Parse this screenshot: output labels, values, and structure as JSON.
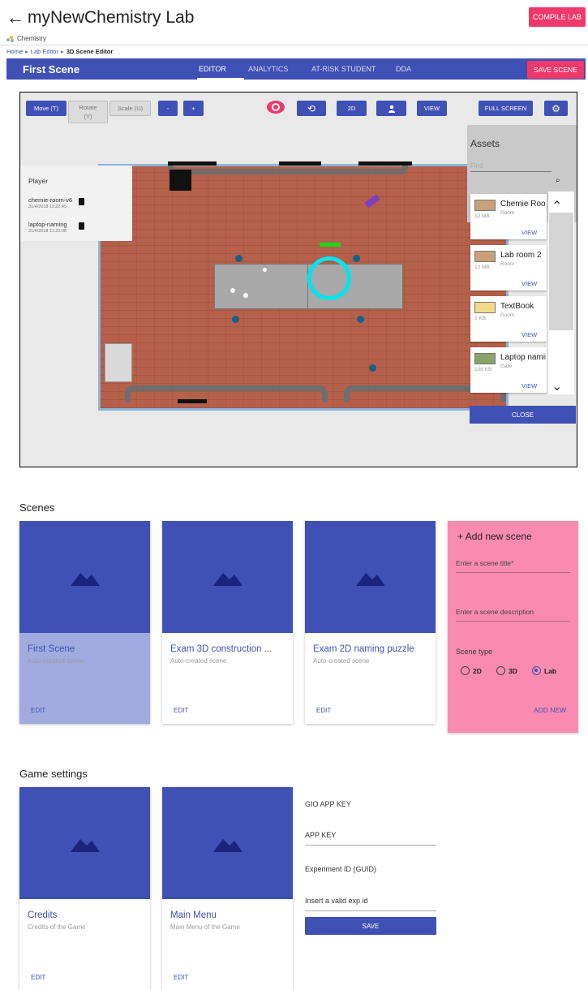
{
  "header": {
    "back_icon": "arrow-left-icon",
    "title": "myNewChemistry Lab",
    "compile_label": "COMPILE LAB",
    "category": "Chemistry"
  },
  "breadcrumb": {
    "items": [
      "Home",
      "Lab Editor",
      "3D Scene Editor"
    ]
  },
  "navbar": {
    "scene_name": "First Scene",
    "tabs": [
      "EDITOR",
      "ANALYTICS",
      "AT-RISK STUDENT",
      "DDA"
    ],
    "active_tab": "EDITOR",
    "save_label": "SAVE SCENE"
  },
  "toolbar": {
    "move": "Move (T)",
    "rotate_line1": "Rotate",
    "rotate_line2": "(Y)",
    "scale": "Scale (U)",
    "minus": "-",
    "plus": "+",
    "twod": "2D",
    "view": "VIEW",
    "fullscreen": "FULL SCREEN"
  },
  "player_panel": {
    "title": "Player",
    "items": [
      {
        "name": "chemie-room-v6",
        "date": "31/4/2018 11:22:45"
      },
      {
        "name": "laptop-naming",
        "date": "31/4/2018 11:23:08"
      }
    ]
  },
  "assets": {
    "title": "Assets",
    "find_placeholder": "Find",
    "items": [
      {
        "name": "Chemie Room",
        "type": "Room",
        "size": "12 MB",
        "action": "VIEW"
      },
      {
        "name": "Lab room 2",
        "type": "Room",
        "size": "12 MB",
        "action": "VIEW"
      },
      {
        "name": "TextBook",
        "type": "Room",
        "size": "1 KB",
        "action": "VIEW"
      },
      {
        "name": "Laptop naming",
        "type": "Gate",
        "size": "106 KB",
        "action": "VIEW"
      }
    ],
    "close_label": "CLOSE"
  },
  "scenes": {
    "title": "Scenes",
    "cards": [
      {
        "title": "First Scene",
        "subtitle": "Auto-created scene",
        "action": "EDIT"
      },
      {
        "title": "Exam 3D construction ...",
        "subtitle": "Auto-created scene",
        "action": "EDIT"
      },
      {
        "title": "Exam 2D naming puzzle",
        "subtitle": "Auto-created scene",
        "action": "EDIT"
      }
    ],
    "add": {
      "header": "Add new scene",
      "title_placeholder": "Enter a scene title*",
      "desc_placeholder": "Enter a scene description",
      "type_label": "Scene type",
      "types": [
        "2D",
        "3D",
        "Lab"
      ],
      "selected_type": "Lab",
      "action": "ADD NEW"
    }
  },
  "game_settings": {
    "title": "Game settings",
    "cards": [
      {
        "title": "Credits",
        "subtitle": "Credits of the Game",
        "action": "EDIT"
      },
      {
        "title": "Main Menu",
        "subtitle": "Main Menu of the Game",
        "action": "EDIT"
      }
    ],
    "gio_label": "GIO APP KEY",
    "app_key_placeholder": "APP KEY",
    "exp_label": "Experiment ID (GUID)",
    "exp_placeholder": "Insert a valid exp id",
    "save_label": "SAVE"
  },
  "colors": {
    "primary": "#3f51b5",
    "accent": "#f0386b",
    "add_card": "#f98bb1",
    "selected_card": "#a1abe0"
  }
}
